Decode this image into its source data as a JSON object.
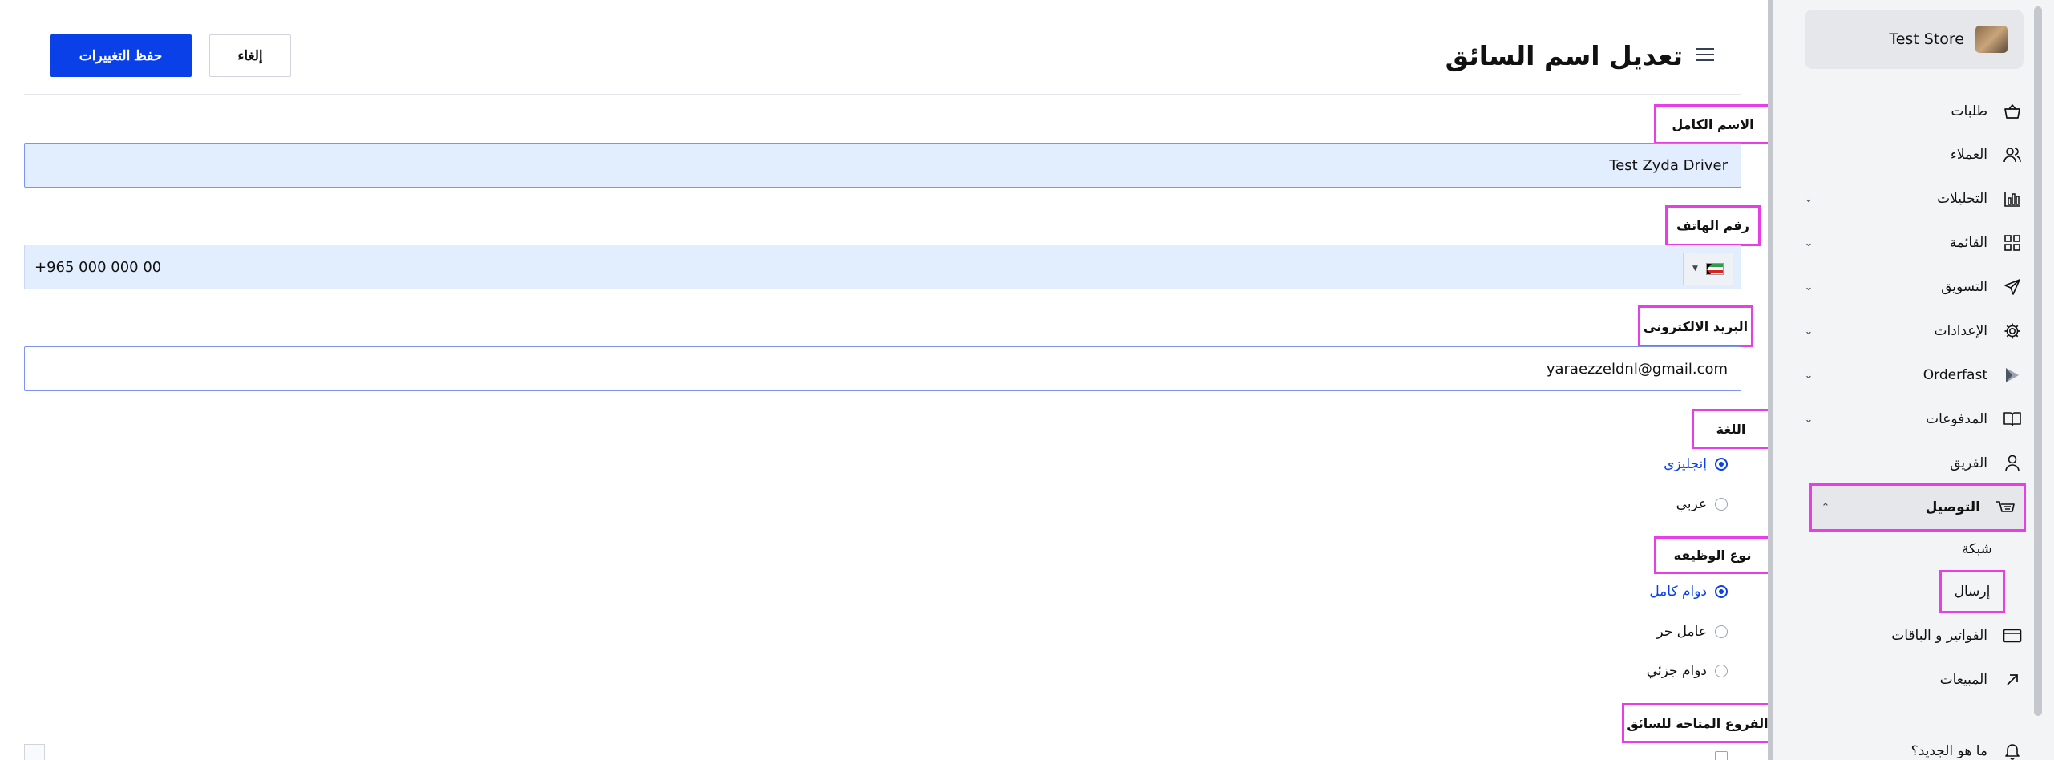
{
  "page": {
    "title": "تعديل اسم السائق",
    "save_label": "حفظ التغييرات",
    "cancel_label": "إلغاء"
  },
  "form": {
    "full_name": {
      "label": "الاسم الكامل",
      "value": "Test Zyda Driver"
    },
    "phone": {
      "label": "رقم الهاتف",
      "value": "+965 000 000 00",
      "country": "Kuwait"
    },
    "email": {
      "label": "البريد الالكتروني",
      "value": "yaraezzeldnl@gmail.com"
    },
    "language": {
      "label": "اللغة",
      "options": [
        {
          "label": "إنجليزي",
          "selected": true
        },
        {
          "label": "عربي",
          "selected": false
        }
      ]
    },
    "job_type": {
      "label": "نوع الوظيفه",
      "options": [
        {
          "label": "دوام كامل",
          "selected": true
        },
        {
          "label": "عامل حر",
          "selected": false
        },
        {
          "label": "دوام جزئي",
          "selected": false
        }
      ]
    },
    "branches": {
      "label": "الفروع المتاحة للسائق"
    }
  },
  "sidebar": {
    "store_name": "Test Store",
    "items": [
      {
        "label": "طلبات",
        "icon": "basket-icon",
        "has_chevron": false
      },
      {
        "label": "العملاء",
        "icon": "users-icon",
        "has_chevron": false
      },
      {
        "label": "التحليلات",
        "icon": "bar-chart-icon",
        "has_chevron": true
      },
      {
        "label": "القائمة",
        "icon": "grid-icon",
        "has_chevron": true
      },
      {
        "label": "التسويق",
        "icon": "send-icon",
        "has_chevron": true
      },
      {
        "label": "الإعدادات",
        "icon": "gear-icon",
        "has_chevron": true
      },
      {
        "label": "Orderfast",
        "icon": "play-icon",
        "has_chevron": true
      },
      {
        "label": "المدفوعات",
        "icon": "book-icon",
        "has_chevron": true
      },
      {
        "label": "الفريق",
        "icon": "user-icon",
        "has_chevron": false
      },
      {
        "label": "التوصيل",
        "icon": "delivery-icon",
        "has_chevron": true,
        "expanded": true,
        "active": true
      },
      {
        "label": "الفواتير و الباقات",
        "icon": "card-icon",
        "has_chevron": false
      },
      {
        "label": "المبيعات",
        "icon": "arrow-up-right-icon",
        "has_chevron": false
      },
      {
        "label": "ما هو الجديد؟",
        "icon": "bell-icon",
        "has_chevron": false
      }
    ],
    "delivery_sub": [
      {
        "label": "شبكة"
      },
      {
        "label": "إرسال",
        "active": true
      }
    ]
  },
  "colors": {
    "primary": "#0a40e8",
    "highlight": "#e83ee8",
    "input_fill": "#e2edfd",
    "sidebar_bg": "#f3f4f6"
  }
}
